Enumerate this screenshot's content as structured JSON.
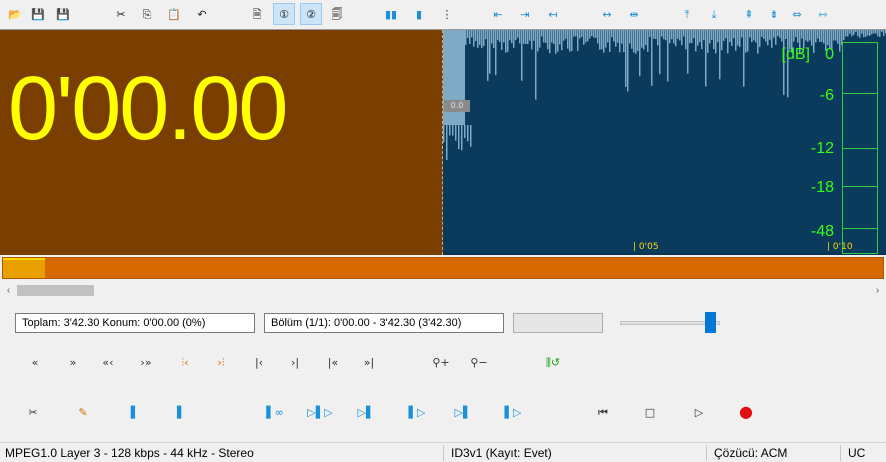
{
  "toolbar": {
    "buttons": [
      {
        "name": "open-folder-icon",
        "glyph": "📂"
      },
      {
        "name": "save-waveform-icon",
        "glyph": "💾"
      },
      {
        "name": "save-list-icon",
        "glyph": "💾"
      },
      {
        "name": "cut-icon",
        "glyph": "✂"
      },
      {
        "name": "copy-icon",
        "glyph": "⎘"
      },
      {
        "name": "paste-icon",
        "glyph": "📋"
      },
      {
        "name": "undo-icon",
        "glyph": "↶"
      },
      {
        "name": "file-info-icon",
        "glyph": "🗎"
      },
      {
        "name": "page-1-icon",
        "glyph": "①"
      },
      {
        "name": "page-2-icon",
        "glyph": "②"
      },
      {
        "name": "page-search-icon",
        "glyph": "🗐"
      },
      {
        "name": "split-blue-icon",
        "glyph": "▮▮"
      },
      {
        "name": "marker-blue-icon",
        "glyph": "▮"
      },
      {
        "name": "dotted-marker-icon",
        "glyph": "⋮"
      },
      {
        "name": "cut-point-left-icon",
        "glyph": "⇤"
      },
      {
        "name": "cut-point-right-icon",
        "glyph": "⇥"
      },
      {
        "name": "move-marker-left-icon",
        "glyph": "↤"
      },
      {
        "name": "expand-marker-icon",
        "glyph": "↔"
      },
      {
        "name": "move-marker-both-icon",
        "glyph": "⇹"
      },
      {
        "name": "align-left-icon",
        "glyph": "⤒"
      },
      {
        "name": "align-right-icon",
        "glyph": "⤓"
      },
      {
        "name": "align-start-icon",
        "glyph": "⇞"
      },
      {
        "name": "align-end-icon",
        "glyph": "⇟"
      },
      {
        "name": "shrink-icon",
        "glyph": "⇔"
      },
      {
        "name": "expand-icon",
        "glyph": "⇿"
      }
    ]
  },
  "time_display": "0'00.00",
  "position_label": "0.0",
  "db_scale": {
    "unit": "[dB]",
    "levels": [
      "0",
      "-6",
      "-12",
      "-18",
      "-48"
    ]
  },
  "timeline": {
    "ticks": [
      "0'05",
      "0'10"
    ]
  },
  "info": {
    "total": "Toplam: 3'42.30   Konum: 0'00.00   (0%)",
    "section": "Bölüm (1/1): 0'00.00 - 3'42.30 (3'42.30)"
  },
  "volume": {
    "level": 0.93
  },
  "nav_buttons": [
    {
      "name": "prev-frame-icon",
      "glyph": "«"
    },
    {
      "name": "next-frame-icon",
      "glyph": "»"
    },
    {
      "name": "rewind-fast-icon",
      "glyph": "«‹"
    },
    {
      "name": "forward-fast-icon",
      "glyph": "›»"
    },
    {
      "name": "goto-section-start-icon",
      "glyph": "⫶‹"
    },
    {
      "name": "goto-section-end-icon",
      "glyph": "›⫶"
    },
    {
      "name": "goto-begin-icon",
      "glyph": "|‹"
    },
    {
      "name": "goto-end-icon",
      "glyph": "›|"
    },
    {
      "name": "goto-prev-mark-icon",
      "glyph": "|«"
    },
    {
      "name": "goto-next-mark-icon",
      "glyph": "»|"
    },
    {
      "name": "zoom-in-icon",
      "glyph": "⚲+"
    },
    {
      "name": "zoom-out-icon",
      "glyph": "⚲−"
    },
    {
      "name": "loop-section-icon",
      "glyph": "⫼↺"
    }
  ],
  "edit_buttons": [
    {
      "name": "cut-section-icon",
      "glyph": "✂"
    },
    {
      "name": "erase-marker-icon",
      "glyph": "✎"
    },
    {
      "name": "set-start-marker-icon",
      "glyph": "▌"
    },
    {
      "name": "set-end-marker-icon",
      "glyph": "▐"
    },
    {
      "name": "play-around-marker-icon",
      "glyph": "▌∞"
    },
    {
      "name": "play-section-icon",
      "glyph": "▷▌▷"
    },
    {
      "name": "play-to-marker-icon",
      "glyph": "▷▌"
    },
    {
      "name": "play-from-marker-icon",
      "glyph": "▌▷"
    },
    {
      "name": "play-to-end-icon",
      "glyph": "▷▌"
    },
    {
      "name": "play-from-end-icon",
      "glyph": "▌▷"
    },
    {
      "name": "skip-start-icon",
      "glyph": "⏮"
    },
    {
      "name": "stop-icon",
      "glyph": "□"
    },
    {
      "name": "play-icon",
      "glyph": "▷"
    },
    {
      "name": "record-icon",
      "glyph": "●"
    }
  ],
  "status": {
    "format": "MPEG1.0 Layer 3 - 128 kbps - 44 kHz - Stereo",
    "tag": "ID3v1 (Kayıt: Evet)",
    "decoder": "Çözücü: ACM",
    "mode": "UC"
  },
  "colors": {
    "time_bg": "#7a3f00",
    "time_fg": "#ffff00",
    "wave_bg": "#0a3a5c",
    "meter_green": "#2ecc40",
    "progress_orange": "#d66a00"
  }
}
